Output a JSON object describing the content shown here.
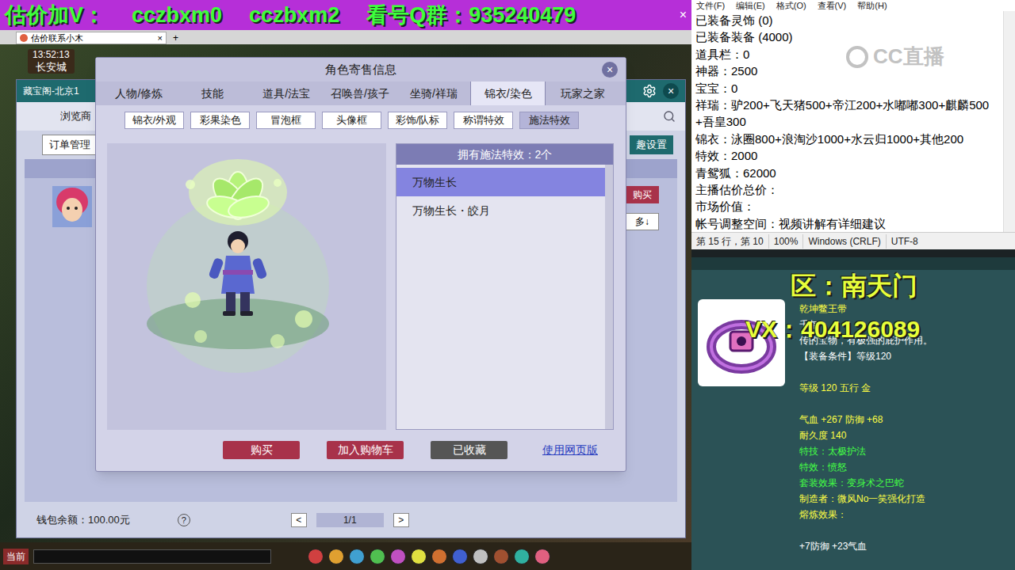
{
  "banner": {
    "parts": [
      "估价加V：",
      "cczbxm0",
      "cczbxm2",
      "看号Q群：935240479"
    ],
    "close": "×"
  },
  "browser": {
    "tab": "估价联系小木",
    "close": "×",
    "add": "+"
  },
  "hud": {
    "time": "13:52:13",
    "location": "长安城"
  },
  "market": {
    "title": "藏宝阁-北京1",
    "close": "×",
    "nav": "浏览商",
    "order": "订单管理",
    "settings": "趣设置",
    "buy": "购买",
    "more": "多↓",
    "wallet": "钱包余额：100.00元",
    "help": "?",
    "pager": {
      "prev": "<",
      "page": "1/1",
      "next": ">"
    }
  },
  "dialog": {
    "title": "角色寄售信息",
    "close": "×",
    "tabs": [
      {
        "label": "人物/修炼",
        "selected": false
      },
      {
        "label": "技能",
        "selected": false
      },
      {
        "label": "道具/法宝",
        "selected": false
      },
      {
        "label": "召唤兽/孩子",
        "selected": false
      },
      {
        "label": "坐骑/祥瑞",
        "selected": false
      },
      {
        "label": "锦衣/染色",
        "selected": true
      },
      {
        "label": "玩家之家",
        "selected": false
      }
    ],
    "subtabs": [
      {
        "label": "锦衣/外观",
        "selected": false
      },
      {
        "label": "彩果染色",
        "selected": false
      },
      {
        "label": "冒泡框",
        "selected": false
      },
      {
        "label": "头像框",
        "selected": false
      },
      {
        "label": "彩饰/队标",
        "selected": false
      },
      {
        "label": "称谓特效",
        "selected": false
      },
      {
        "label": "施法特效",
        "selected": true
      }
    ],
    "list": {
      "header": "拥有施法特效：2个",
      "items": [
        {
          "label": "万物生长",
          "selected": true
        },
        {
          "label": "万物生长・皎月",
          "selected": false
        }
      ]
    },
    "buttons": [
      {
        "label": "购买",
        "kind": "primary"
      },
      {
        "label": "加入购物车",
        "kind": "primary"
      },
      {
        "label": "已收藏",
        "kind": "muted"
      }
    ],
    "link": "使用网页版"
  },
  "chat": {
    "channel": "当前"
  },
  "notepad": {
    "menu": [
      "文件(F)",
      "编辑(E)",
      "格式(O)",
      "查看(V)",
      "帮助(H)"
    ],
    "lines": [
      "已装备灵饰 (0)",
      "已装备装备 (4000)",
      "道具栏：0",
      "神器：2500",
      "宝宝：0",
      "祥瑞：驴200+飞天猪500+帝江200+水嘟嘟300+麒麟500+吾皇300",
      "锦衣：泳圈800+浪淘沙1000+水云归1000+其他200",
      "特效：2000",
      "青鸳狐：62000",
      "主播估价总价：",
      "市场价值：",
      "帐号调整空间：视频讲解有详细建议"
    ],
    "status": [
      "第 15 行，第 10",
      "100%",
      "Windows (CRLF)",
      "UTF-8"
    ],
    "watermark": "CC直播"
  },
  "overlay": {
    "region": "区：南天门",
    "contact": "VX：404126089"
  },
  "item": {
    "sections": [
      [
        {
          "text": "乾坤鳖王带",
          "color": "#ffff44"
        },
        {
          "text": "千年",
          "color": "#ffffff"
        },
        {
          "text": "传的宝物，有极强的庇护作用。",
          "color": "#ffffff"
        },
        {
          "text": "【装备条件】等级120",
          "color": "#ffffff"
        }
      ],
      [
        {
          "text": "等级 120 五行 金",
          "color": "#ffff44"
        }
      ],
      [
        {
          "text": "气血 +267 防御 +68",
          "color": "#ffff44"
        },
        {
          "text": "耐久度 140",
          "color": "#ffff44"
        },
        {
          "text": "特技：太极护法",
          "color": "#44ff44"
        },
        {
          "text": "特效：愤怒",
          "color": "#44ff44"
        },
        {
          "text": "套装效果：变身术之巴蛇",
          "color": "#44ff44"
        },
        {
          "text": "制造者：微风No一笑强化打造",
          "color": "#ffff44"
        },
        {
          "text": "熔炼效果：",
          "color": "#ffff44"
        }
      ],
      [
        {
          "text": "+7防御 +23气血",
          "color": "#ffffff"
        }
      ]
    ]
  }
}
